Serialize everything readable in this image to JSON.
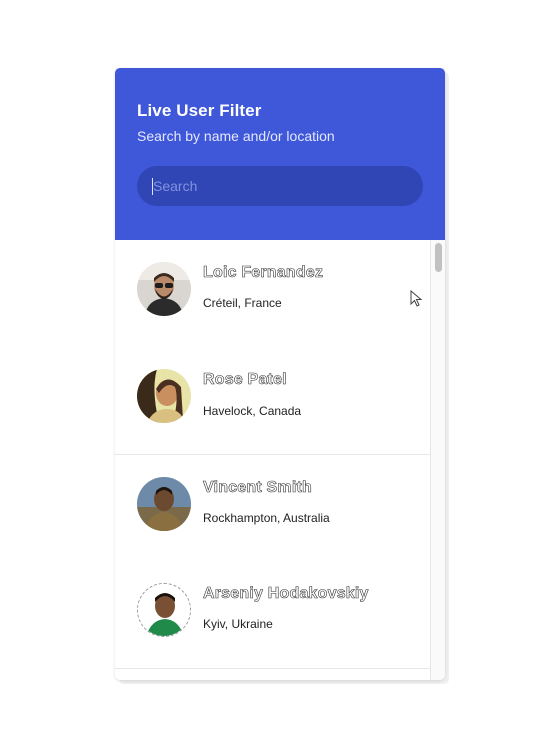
{
  "header": {
    "title": "Live User Filter",
    "subtitle": "Search by name and/or location",
    "accent_color": "#3f57d9"
  },
  "search": {
    "placeholder": "Search",
    "value": ""
  },
  "users": [
    {
      "name": "Loic Fernandez",
      "location": "Créteil, France",
      "avatar_icon": "person-photo"
    },
    {
      "name": "Rose Patel",
      "location": "Havelock, Canada",
      "avatar_icon": "person-photo"
    },
    {
      "name": "Vincent Smith",
      "location": "Rockhampton, Australia",
      "avatar_icon": "person-photo"
    },
    {
      "name": "Arseniy Hodakovskiy",
      "location": "Kyiv, Ukraine",
      "avatar_icon": "person-photo"
    }
  ]
}
